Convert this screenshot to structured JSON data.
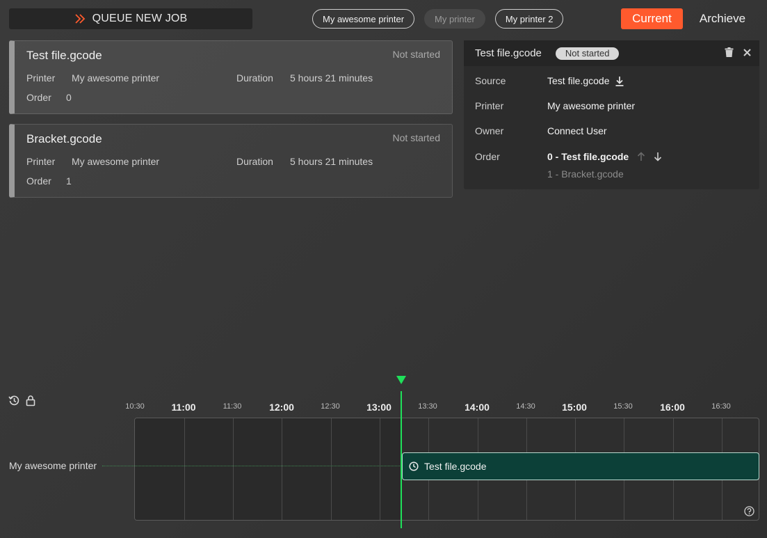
{
  "toolbar": {
    "queue_label": "QUEUE NEW JOB",
    "queue_icon": "double-chevron-right-icon"
  },
  "printer_tabs": [
    {
      "label": "My awesome printer",
      "state": "active"
    },
    {
      "label": "My printer",
      "state": "disabled"
    },
    {
      "label": "My printer 2",
      "state": "active"
    }
  ],
  "view_toggle": {
    "current": "Current",
    "archive": "Archieve"
  },
  "jobs": [
    {
      "name": "Test file.gcode",
      "status": "Not started",
      "printer_label": "Printer",
      "printer": "My awesome printer",
      "duration_label": "Duration",
      "duration": "5 hours 21 minutes",
      "order_label": "Order",
      "order": "0"
    },
    {
      "name": "Bracket.gcode",
      "status": "Not started",
      "printer_label": "Printer",
      "printer": "My awesome printer",
      "duration_label": "Duration",
      "duration": "5 hours 21 minutes",
      "order_label": "Order",
      "order": "1"
    }
  ],
  "detail": {
    "title": "Test file.gcode",
    "status": "Not started",
    "source_label": "Source",
    "source": "Test file.gcode",
    "printer_label": "Printer",
    "printer": "My awesome printer",
    "owner_label": "Owner",
    "owner": "Connect User",
    "order_label": "Order",
    "order_current": "0 - Test file.gcode",
    "order_next": "1 - Bracket.gcode"
  },
  "timeline": {
    "ticks": [
      {
        "label": "10:30",
        "kind": "minor"
      },
      {
        "label": "11:00",
        "kind": "major"
      },
      {
        "label": "11:30",
        "kind": "minor"
      },
      {
        "label": "12:00",
        "kind": "major"
      },
      {
        "label": "12:30",
        "kind": "minor"
      },
      {
        "label": "13:00",
        "kind": "major"
      },
      {
        "label": "13:30",
        "kind": "minor"
      },
      {
        "label": "14:00",
        "kind": "major"
      },
      {
        "label": "14:30",
        "kind": "minor"
      },
      {
        "label": "15:00",
        "kind": "major"
      },
      {
        "label": "15:30",
        "kind": "minor"
      },
      {
        "label": "16:00",
        "kind": "major"
      },
      {
        "label": "16:30",
        "kind": "minor"
      }
    ],
    "row_label": "My awesome printer",
    "job_label": "Test file.gcode"
  },
  "colors": {
    "accent": "#ff5a2d",
    "now": "#1fe05a",
    "job_bar": "#0c4038"
  }
}
